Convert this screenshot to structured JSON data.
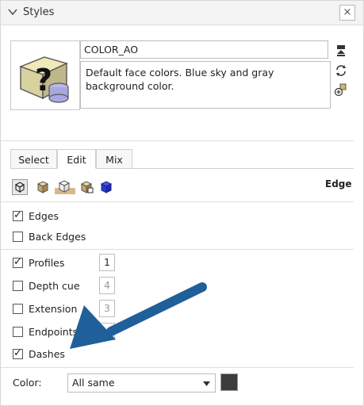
{
  "header": {
    "title": "Styles",
    "close_label": "×"
  },
  "style": {
    "name": "COLOR_AO",
    "description": "Default face colors. Blue sky and gray background color."
  },
  "tabs": [
    {
      "label": "Select"
    },
    {
      "label": "Edit"
    },
    {
      "label": "Mix"
    }
  ],
  "toolbar": {
    "section_label": "Edge"
  },
  "edges": {
    "edges_label": "Edges",
    "back_edges_label": "Back Edges",
    "profiles_label": "Profiles",
    "profiles_value": "1",
    "depth_cue_label": "Depth cue",
    "depth_cue_value": "4",
    "extension_label": "Extension",
    "extension_value": "3",
    "endpoints_label": "Endpoints",
    "dashes_label": "Dashes",
    "check_mark": "✓"
  },
  "color": {
    "label": "Color:",
    "selected": "All same",
    "swatch": "#3c3c3c"
  },
  "colors": {
    "accent_arrow": "#1f5f9a"
  }
}
